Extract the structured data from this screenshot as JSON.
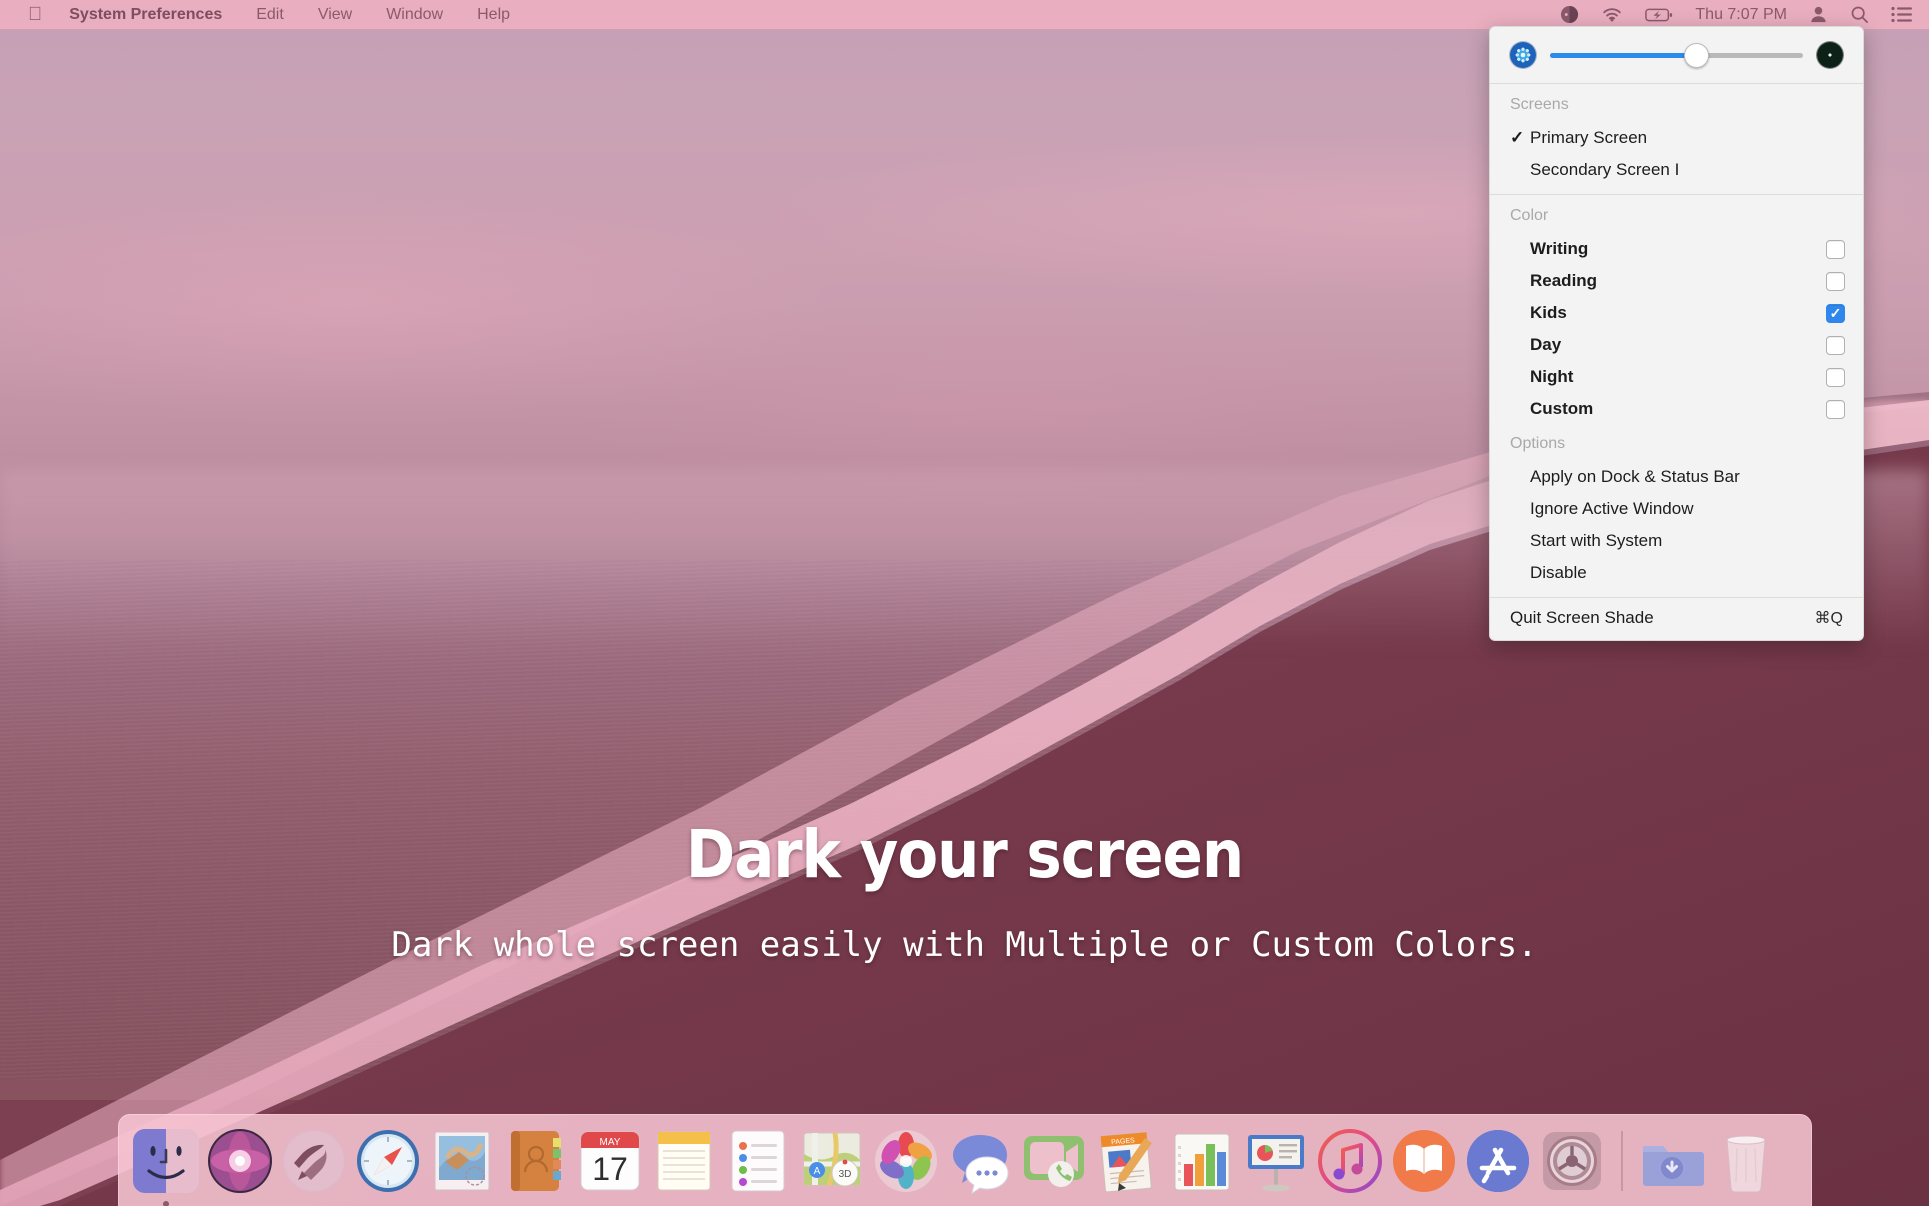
{
  "menubar": {
    "apple_icon": "apple-logo",
    "items": [
      {
        "label": "System Preferences",
        "bold": true
      },
      {
        "label": "Edit",
        "bold": false
      },
      {
        "label": "View",
        "bold": false
      },
      {
        "label": "Window",
        "bold": false
      },
      {
        "label": "Help",
        "bold": false
      }
    ],
    "status": {
      "icons": [
        "screen-shade-icon",
        "wifi-icon",
        "battery-charging-icon"
      ],
      "clock": "Thu 7:07 PM",
      "right_icons": [
        "user-account-icon",
        "spotlight-search-icon",
        "notification-center-icon"
      ]
    }
  },
  "shade_menu": {
    "slider": {
      "left_icon": "brightness-high-icon",
      "right_icon": "brightness-dark-icon",
      "value_percent": 58
    },
    "screens": {
      "header": "Screens",
      "items": [
        {
          "label": "Primary Screen",
          "checked": true
        },
        {
          "label": "Secondary Screen I",
          "checked": false
        }
      ]
    },
    "color": {
      "header": "Color",
      "items": [
        {
          "label": "Writing",
          "checked": false
        },
        {
          "label": "Reading",
          "checked": false
        },
        {
          "label": "Kids",
          "checked": true
        },
        {
          "label": "Day",
          "checked": false
        },
        {
          "label": "Night",
          "checked": false
        },
        {
          "label": "Custom",
          "checked": false
        }
      ]
    },
    "options": {
      "header": "Options",
      "items": [
        {
          "label": "Apply on Dock & Status Bar"
        },
        {
          "label": "Ignore Active Window"
        },
        {
          "label": "Start with System"
        },
        {
          "label": "Disable"
        }
      ]
    },
    "footer": {
      "label": "Quit Screen Shade",
      "shortcut": "⌘Q"
    },
    "accent_color": "#2f86eb"
  },
  "hero": {
    "headline": "Dark your screen",
    "subhead": "Dark whole screen easily with Multiple or Custom Colors."
  },
  "dock": {
    "calendar_month": "MAY",
    "calendar_day": "17",
    "items": [
      {
        "name": "finder",
        "running": true
      },
      {
        "name": "siri",
        "running": false
      },
      {
        "name": "launchpad",
        "running": false
      },
      {
        "name": "safari",
        "running": false
      },
      {
        "name": "mail",
        "running": false
      },
      {
        "name": "contacts",
        "running": false
      },
      {
        "name": "calendar",
        "running": false
      },
      {
        "name": "notes",
        "running": false
      },
      {
        "name": "reminders",
        "running": false
      },
      {
        "name": "maps",
        "running": false
      },
      {
        "name": "photos",
        "running": false
      },
      {
        "name": "messages",
        "running": false
      },
      {
        "name": "facetime",
        "running": false
      },
      {
        "name": "pages",
        "running": false
      },
      {
        "name": "numbers",
        "running": false
      },
      {
        "name": "keynote",
        "running": false
      },
      {
        "name": "itunes",
        "running": false
      },
      {
        "name": "ibooks",
        "running": false
      },
      {
        "name": "app-store",
        "running": false
      },
      {
        "name": "system-preferences",
        "running": false
      }
    ],
    "right_items": [
      {
        "name": "downloads-folder"
      },
      {
        "name": "trash"
      }
    ]
  }
}
